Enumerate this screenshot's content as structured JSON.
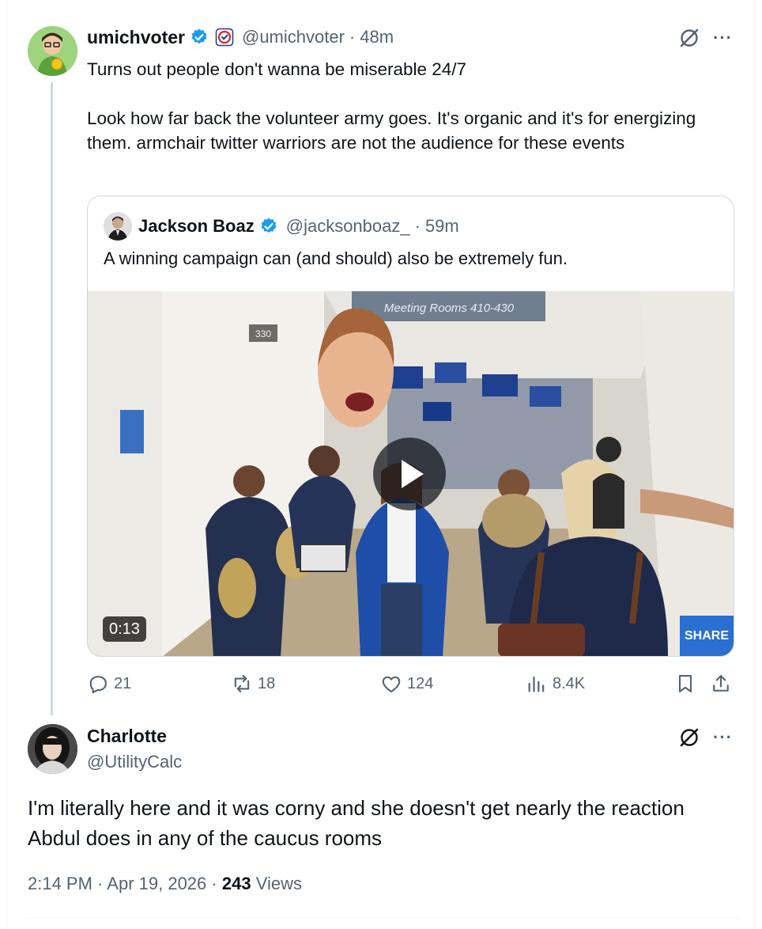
{
  "main_post": {
    "display_name": "umichvoter",
    "handle": "@umichvoter",
    "separator": "·",
    "time": "48m",
    "text": "Turns out people don't wanna be miserable 24/7\n\nLook how far back the volunteer army goes. It's organic and it's for energizing them. armchair twitter warriors are not the audience for these events"
  },
  "quoted_post": {
    "display_name": "Jackson Boaz",
    "handle": "@jacksonboaz_",
    "separator": "·",
    "time": "59m",
    "text": "A winning campaign can (and should) also be extremely fun.",
    "video": {
      "duration": "0:13",
      "sign_text": "Meeting Rooms 410-430",
      "room_number": "330",
      "board_text": "SHARE"
    }
  },
  "actions": {
    "replies": "21",
    "reposts": "18",
    "likes": "124",
    "views": "8.4K"
  },
  "reply": {
    "display_name": "Charlotte",
    "handle": "@UtilityCalc",
    "text": "I'm literally here and it was corny and she doesn't get nearly the reaction Abdul does in any of the caucus rooms",
    "time": "2:14 PM",
    "sep1": "·",
    "date": "Apr 19, 2026",
    "sep2": "·",
    "views_count": "243",
    "views_label": "Views"
  },
  "icons": {
    "verified": "verified-badge-icon",
    "affiliate": "affiliate-badge-icon",
    "grok": "grok-icon",
    "more": "more-icon",
    "reply": "reply-icon",
    "repost": "repost-icon",
    "like": "like-icon",
    "views": "views-icon",
    "bookmark": "bookmark-icon",
    "share": "share-icon",
    "play": "play-icon"
  },
  "colors": {
    "text": "#0f1419",
    "muted": "#536471",
    "verified_blue": "#1d9bf0",
    "border": "#cfd9de"
  }
}
